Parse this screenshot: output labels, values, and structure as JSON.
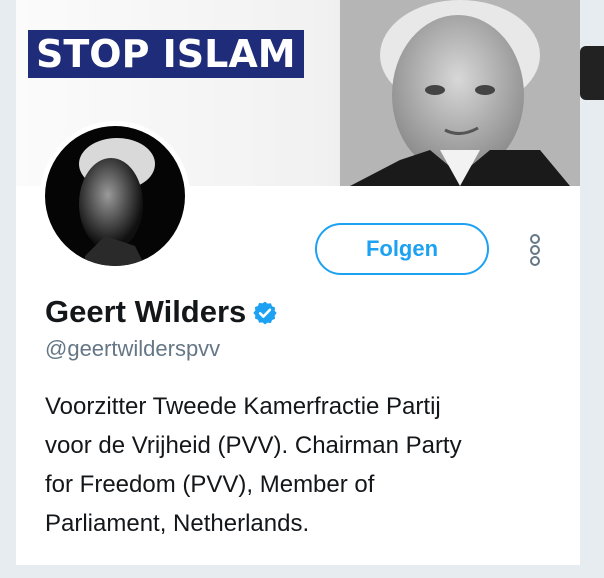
{
  "banner": {
    "slogan": "STOP ISLAM"
  },
  "profile": {
    "display_name": "Geert Wilders",
    "verified": true,
    "handle": "@geertwilderspvv",
    "bio": "Voorzitter Tweede Kamerfractie Partij\nvoor de Vrijheid (PVV). Chairman Party\nfor Freedom (PVV), Member of\nParliament, Netherlands."
  },
  "actions": {
    "follow_label": "Folgen",
    "more_icon": "more-vertical-icon"
  },
  "colors": {
    "accent": "#1da1f2",
    "slogan_bg": "#1e2c79",
    "text": "#14171a",
    "muted": "#657786",
    "page_bg": "#e6ecf0"
  }
}
